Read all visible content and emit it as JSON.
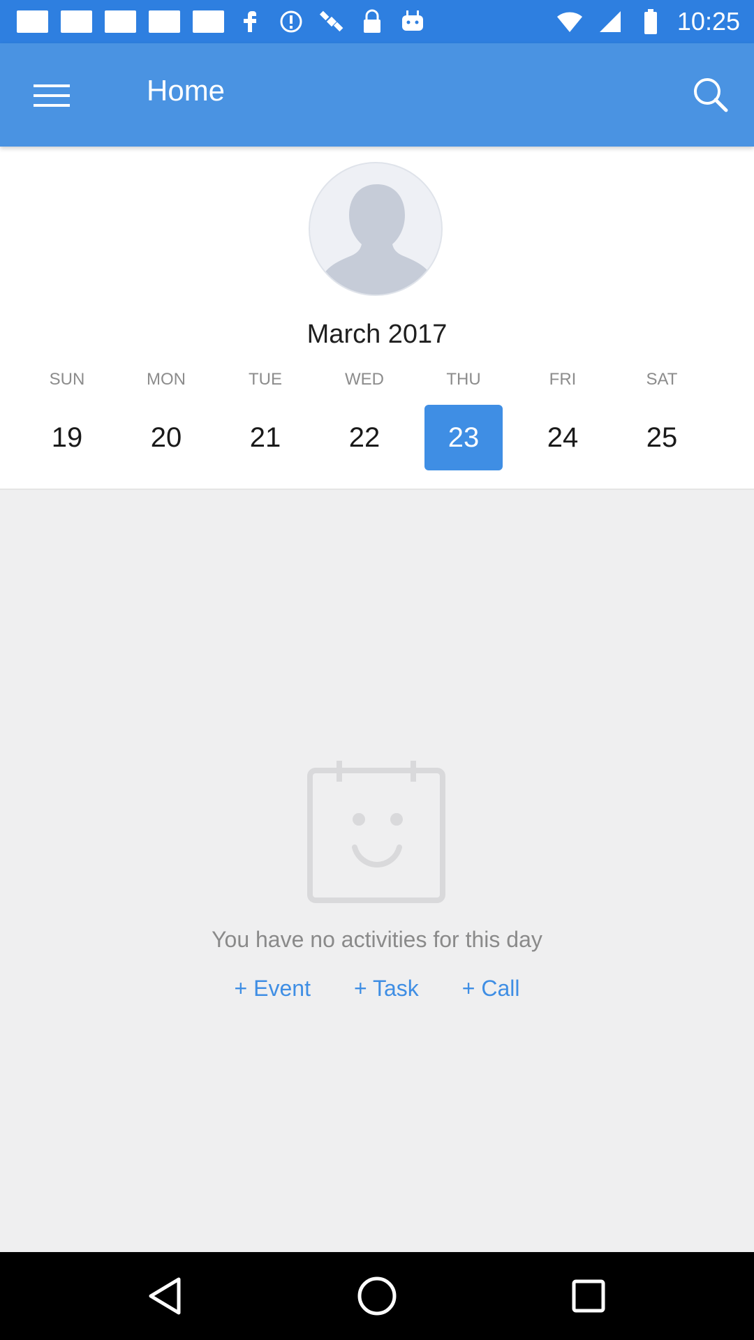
{
  "status_bar": {
    "time": "10:25",
    "icons": [
      "notification-square",
      "notification-square",
      "notification-square",
      "notification-square",
      "notification-square",
      "facebook-icon",
      "alert-icon",
      "satellite-icon",
      "lock-icon",
      "android-icon",
      "wifi-icon",
      "signal-icon",
      "battery-icon"
    ]
  },
  "app_bar": {
    "title": "Home",
    "menu_icon": "hamburger-menu-icon",
    "search_icon": "search-icon"
  },
  "calendar": {
    "month_label": "March 2017",
    "days": [
      {
        "name": "SUN",
        "number": "19"
      },
      {
        "name": "MON",
        "number": "20"
      },
      {
        "name": "TUE",
        "number": "21"
      },
      {
        "name": "WED",
        "number": "22"
      },
      {
        "name": "THU",
        "number": "23"
      },
      {
        "name": "FRI",
        "number": "24"
      },
      {
        "name": "SAT",
        "number": "25"
      }
    ],
    "selected_index": 4
  },
  "empty_state": {
    "icon": "calendar-smile-icon",
    "message": "You have no activities for this day",
    "actions": {
      "event": "+ Event",
      "task": "+ Task",
      "call": "+ Call"
    }
  },
  "nav_bar": {
    "back_icon": "back-triangle-icon",
    "home_icon": "home-circle-icon",
    "recents_icon": "recents-square-icon"
  },
  "colors": {
    "status_bar": "#2e7fe0",
    "app_bar": "#4a93e2",
    "accent": "#3f8ee4",
    "background": "#efeff0"
  }
}
